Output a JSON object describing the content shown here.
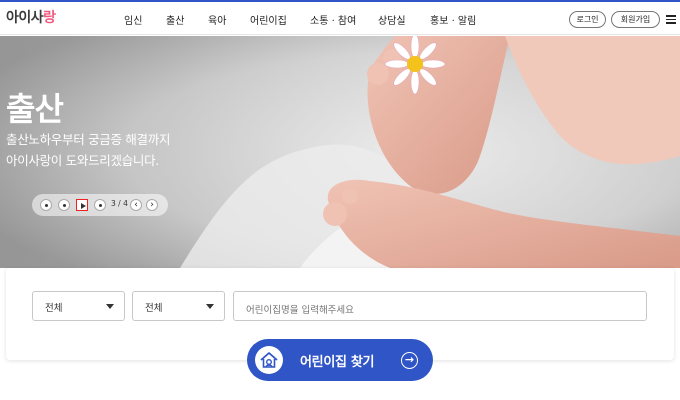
{
  "header": {
    "logo_main": "아이사",
    "logo_accent": "랑",
    "nav": [
      "임신",
      "출산",
      "육아",
      "어린이집",
      "소통 · 참여",
      "상담실",
      "홍보 · 알림"
    ],
    "login_label": "로그인",
    "join_label": "회원가입"
  },
  "hero": {
    "title": "출산",
    "subtitle_line1": "출산노하우부터 궁금증 해결까지",
    "subtitle_line2": "아이사랑이 도와드리겠습니다.",
    "slide_counter": "3 / 4",
    "prev_label": "‹",
    "next_label": "›"
  },
  "search": {
    "select1_value": "전체",
    "select2_value": "전체",
    "input_placeholder": "어린이집명을 입력해주세요",
    "button_label": "어린이집 찾기",
    "button_arrow": "→"
  },
  "colors": {
    "accent": "#2f55c6",
    "logo_accent": "#f05a7e"
  }
}
